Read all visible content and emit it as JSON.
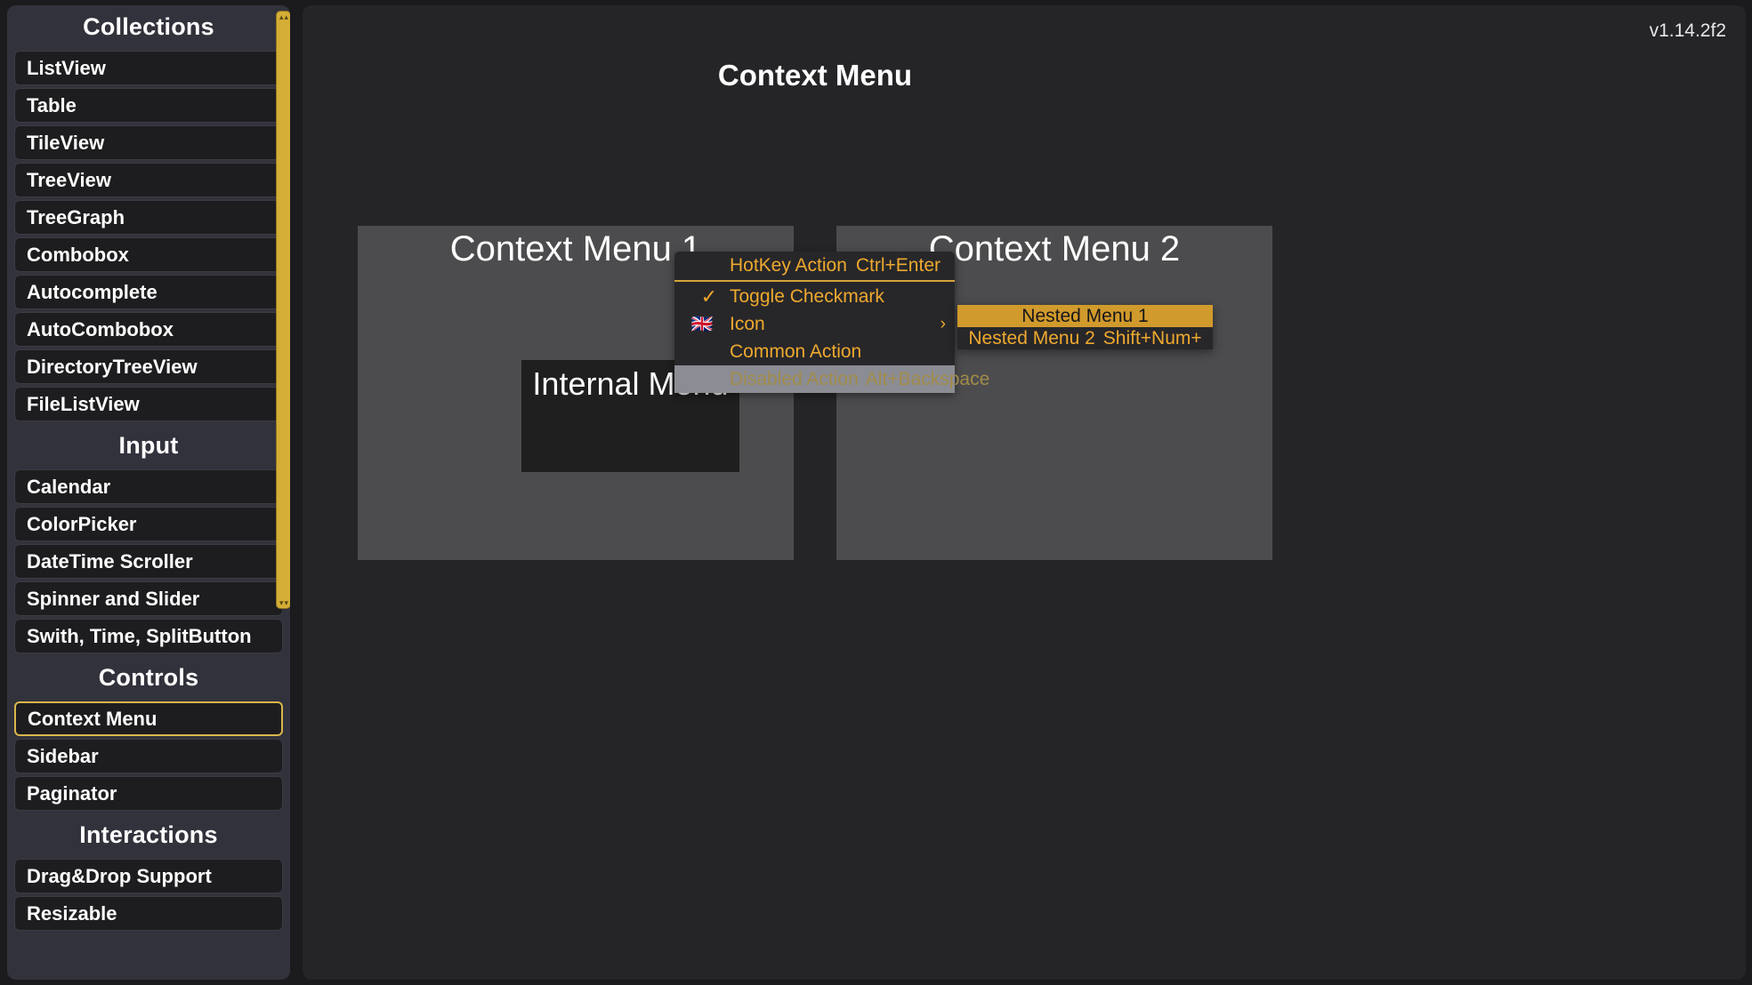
{
  "app": {
    "version": "v1.14.2f2",
    "page_title": "Context Menu",
    "accent_color": "#efa92e",
    "highlight_color": "#d19a2c",
    "scrollbar_color": "#d4ae36",
    "panel_color": "#4c4c4e",
    "sidebar_color": "#32323c"
  },
  "sidebar": {
    "sections": [
      {
        "header": "Collections",
        "items": [
          {
            "label": "ListView",
            "selected": false
          },
          {
            "label": "Table",
            "selected": false
          },
          {
            "label": "TileView",
            "selected": false
          },
          {
            "label": "TreeView",
            "selected": false
          },
          {
            "label": "TreeGraph",
            "selected": false
          },
          {
            "label": "Combobox",
            "selected": false
          },
          {
            "label": "Autocomplete",
            "selected": false
          },
          {
            "label": "AutoCombobox",
            "selected": false
          },
          {
            "label": "DirectoryTreeView",
            "selected": false
          },
          {
            "label": "FileListView",
            "selected": false
          }
        ]
      },
      {
        "header": "Input",
        "items": [
          {
            "label": "Calendar",
            "selected": false
          },
          {
            "label": "ColorPicker",
            "selected": false
          },
          {
            "label": "DateTime Scroller",
            "selected": false
          },
          {
            "label": "Spinner and Slider",
            "selected": false
          },
          {
            "label": "Swith, Time, SplitButton",
            "selected": false
          }
        ]
      },
      {
        "header": "Controls",
        "items": [
          {
            "label": "Context Menu",
            "selected": true
          },
          {
            "label": "Sidebar",
            "selected": false
          },
          {
            "label": "Paginator",
            "selected": false
          }
        ]
      },
      {
        "header": "Interactions",
        "items": [
          {
            "label": "Drag&Drop Support",
            "selected": false
          },
          {
            "label": "Resizable",
            "selected": false
          }
        ]
      }
    ],
    "scrollbar": {
      "grip_top": "▴▴",
      "grip_bottom": "▾▾"
    }
  },
  "main": {
    "panels": [
      {
        "title": "Context Menu 1"
      },
      {
        "title": "Context Menu 2"
      }
    ],
    "internal_menu": {
      "title": "Internal Menu"
    }
  },
  "context_menu": {
    "items": [
      {
        "kind": "item",
        "icon": "",
        "check": "",
        "label": "HotKey Action",
        "shortcut": "Ctrl+Enter",
        "arrow": "",
        "disabled": false
      },
      {
        "kind": "separator"
      },
      {
        "kind": "item",
        "icon": "",
        "check": "✓",
        "label": "Toggle Checkmark",
        "shortcut": "",
        "arrow": "",
        "disabled": false
      },
      {
        "kind": "item",
        "icon": "🇬🇧",
        "check": "",
        "label": "Icon",
        "shortcut": "",
        "arrow": "›",
        "disabled": false
      },
      {
        "kind": "item",
        "icon": "",
        "check": "",
        "label": "Common Action",
        "shortcut": "",
        "arrow": "",
        "disabled": false
      },
      {
        "kind": "item",
        "icon": "",
        "check": "",
        "label": "Disabled Action",
        "shortcut": "Alt+Backspace",
        "arrow": "",
        "disabled": true
      }
    ]
  },
  "nested_menu": {
    "items": [
      {
        "label": "Nested Menu 1",
        "shortcut": "",
        "highlighted": true
      },
      {
        "label": "Nested Menu 2",
        "shortcut": "Shift+Num+",
        "highlighted": false
      }
    ]
  }
}
